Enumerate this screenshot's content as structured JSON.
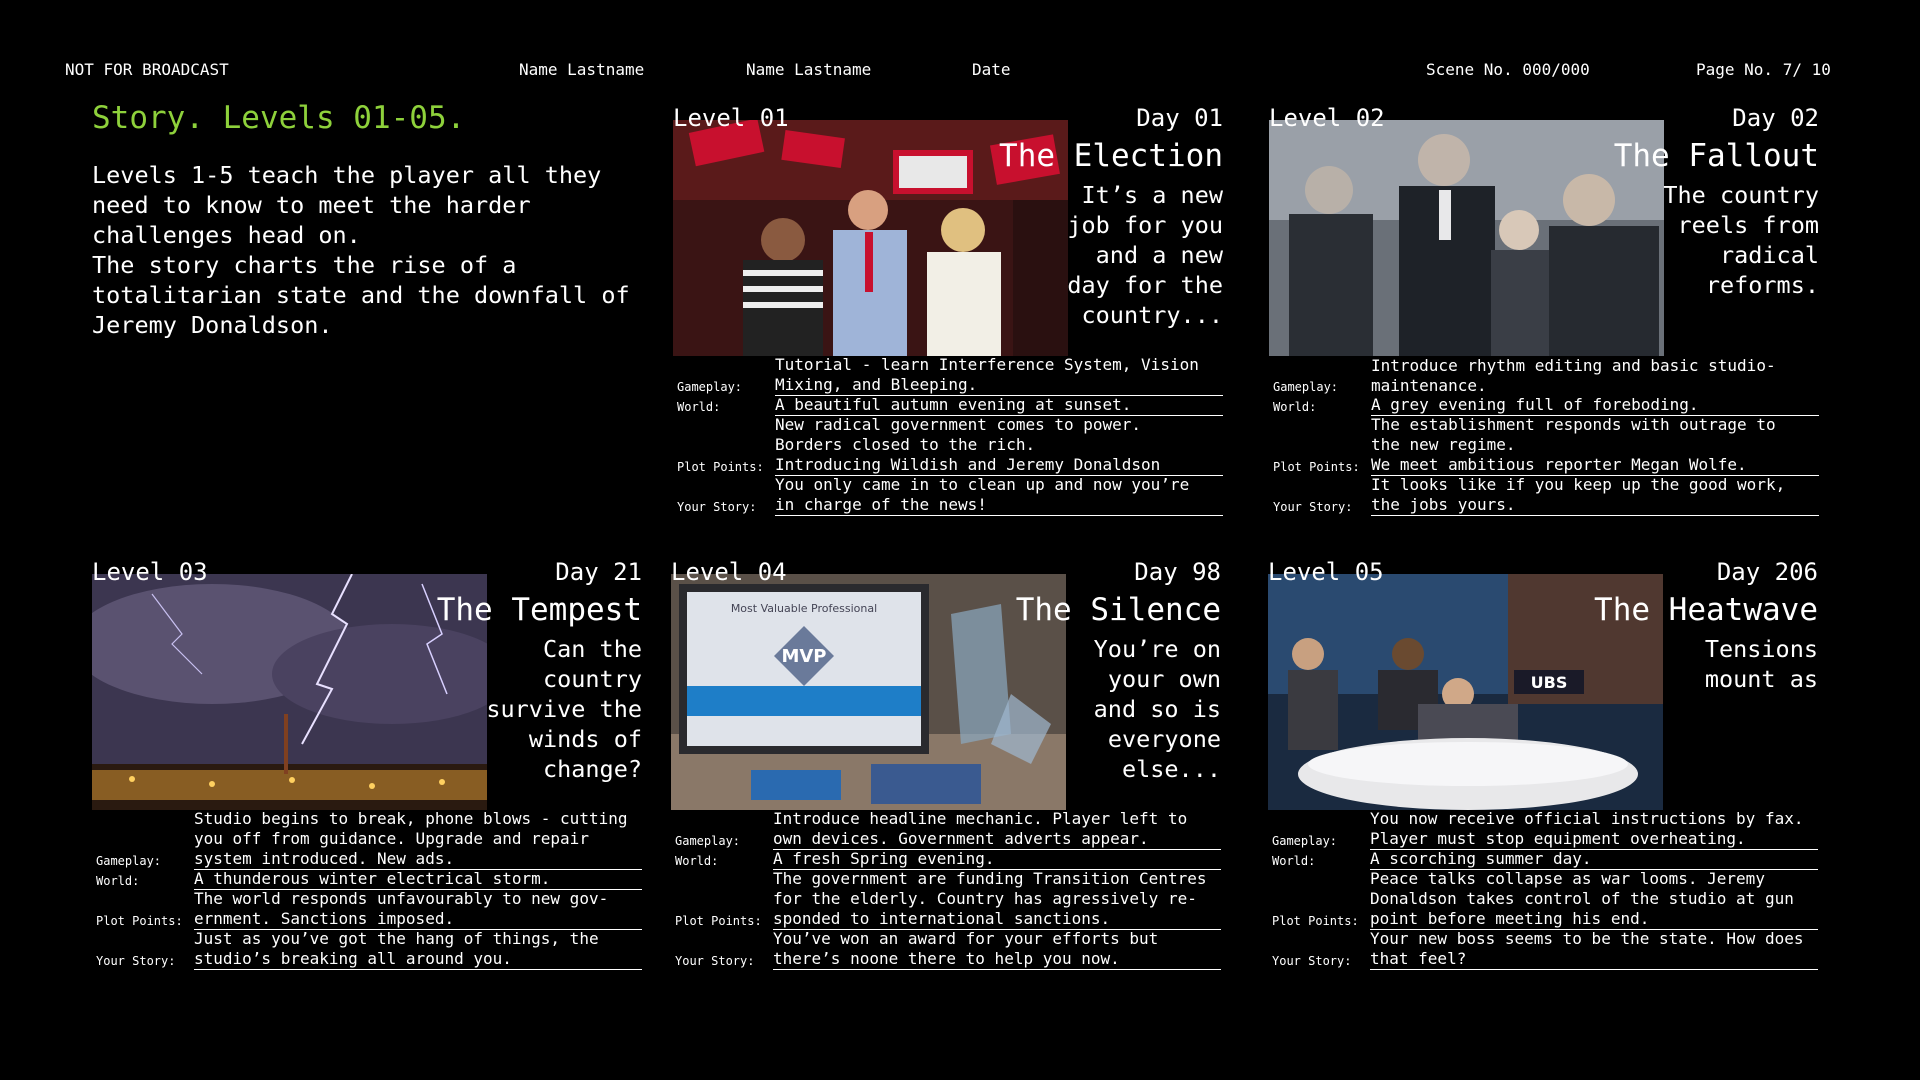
{
  "header": {
    "not_for_broadcast": "NOT FOR BROADCAST",
    "name1": "Name Lastname",
    "name2": "Name Lastname",
    "date": "Date",
    "scene": "Scene No. 000/000",
    "page": "Page No. 7/ 10"
  },
  "intro": {
    "title": "Story. Levels 01-05.",
    "body": "Levels 1-5 teach the player all they\nneed to know to meet the harder\nchallenges head on.\nThe story charts the rise of a\ntotalitarian state and the downfall of\nJeremy Donaldson."
  },
  "row_labels": {
    "gameplay": "Gameplay:",
    "world": "World:",
    "plot": "Plot Points:",
    "story": "Your Story:"
  },
  "levels": [
    {
      "level": "Level 01",
      "day": "Day 01",
      "title": "The Election",
      "blurb": "It’s a new job for you and a new day for the country...",
      "photo": "election-rally-photo",
      "gameplay": "Tutorial - learn Interference System, Vision\nMixing, and Bleeping.",
      "world": "A beautiful autumn evening at sunset.",
      "plot": "New radical government comes to power.\nBorders closed to the rich.\nIntroducing Wildish and Jeremy Donaldson",
      "story": "You only came in to clean up and now you’re\nin charge of the news!"
    },
    {
      "level": "Level 02",
      "day": "Day 02",
      "title": "The Fallout",
      "blurb": "The country reels from radical reforms.",
      "photo": "politicians-crowd-photo",
      "gameplay": "Introduce rhythm editing and basic studio-\nmaintenance.",
      "world": "A grey evening full of foreboding.",
      "plot": "The establishment responds with outrage to\nthe new regime.\nWe meet ambitious reporter Megan Wolfe.",
      "story": "It looks like if you keep up the good work,\nthe jobs yours."
    },
    {
      "level": "Level 03",
      "day": "Day 21",
      "title": "The Tempest",
      "blurb": "Can the country survive the winds of change?",
      "photo": "lightning-storm-photo",
      "gameplay": "Studio begins to break, phone blows - cutting\nyou off from guidance. Upgrade and repair\nsystem introduced. New ads.",
      "world": "A thunderous winter electrical storm.",
      "plot": "The world responds unfavourably to new gov-\nernment. Sanctions imposed.",
      "story": "Just as you’ve got the hang of things, the\nstudio’s breaking all around you."
    },
    {
      "level": "Level 04",
      "day": "Day 98",
      "title": "The Silence",
      "blurb": "You’re on your own and so is everyone else...",
      "photo": "mvp-award-photo",
      "photo_text": "Most Valuable Professional",
      "photo_badge": "MVP",
      "gameplay": "Introduce headline mechanic. Player left to\nown devices. Government adverts appear.",
      "world": "A fresh Spring evening.",
      "plot": "The government are funding Transition Centres\nfor the elderly. Country has agressively re-\nsponded to international sanctions.",
      "story": "You’ve won an award for your efforts but\nthere’s noone there to help you now."
    },
    {
      "level": "Level 05",
      "day": "Day 206",
      "title": "The Heatwave",
      "blurb": "Tensions mount as",
      "photo": "news-studio-fight-photo",
      "photo_text": "UBS",
      "gameplay": "You now receive official instructions by fax.\nPlayer must stop equipment overheating.",
      "world": "A scorching summer day.",
      "plot": "Peace talks collapse as war looms. Jeremy\nDonaldson takes control of the studio at gun\npoint before meeting his end.",
      "story": "Your new boss seems to be the state. How does\nthat feel?"
    }
  ]
}
